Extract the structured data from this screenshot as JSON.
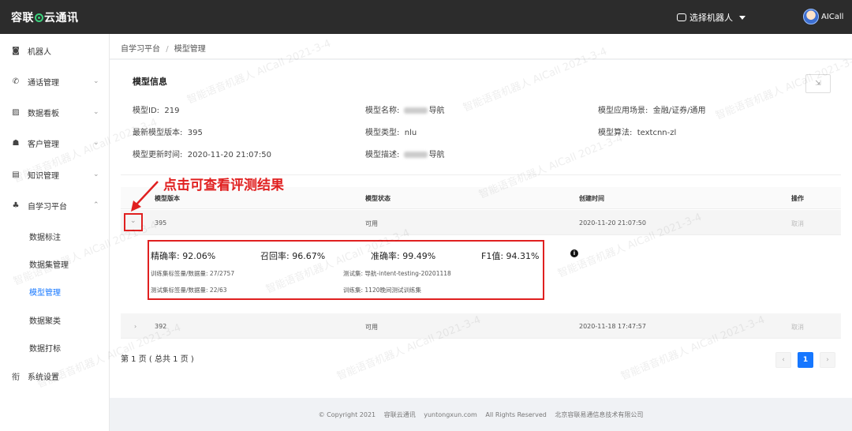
{
  "header": {
    "brand_left": "容联",
    "brand_right": "云通讯",
    "robot_select": "选择机器人",
    "user": "AICall"
  },
  "sidebar": {
    "items": [
      {
        "label": "机器人",
        "icon": "robot-icon"
      },
      {
        "label": "通话管理",
        "icon": "phone-icon"
      },
      {
        "label": "数据看板",
        "icon": "chart-icon"
      },
      {
        "label": "客户管理",
        "icon": "users-icon"
      },
      {
        "label": "知识管理",
        "icon": "book-icon"
      },
      {
        "label": "自学习平台",
        "icon": "learn-icon"
      }
    ],
    "subitems": [
      "数据标注",
      "数据集管理",
      "模型管理",
      "数据聚类",
      "数据打标"
    ],
    "last": {
      "label": "系统设置",
      "icon": "settings-icon"
    }
  },
  "breadcrumb": {
    "parent": "自学习平台",
    "sep": "/",
    "current": "模型管理"
  },
  "model_info": {
    "title": "模型信息",
    "id_label": "模型ID:",
    "id": "219",
    "name_label": "模型名称:",
    "name_suffix": "导航",
    "scene_label": "模型应用场景:",
    "scene": "金融/证券/通用",
    "version_label": "最新模型版本:",
    "version": "395",
    "type_label": "模型类型:",
    "type": "nlu",
    "algo_label": "模型算法:",
    "algo": "textcnn-zl",
    "updated_label": "模型更新时间:",
    "updated": "2020-11-20 21:07:50",
    "desc_label": "模型描述:",
    "desc_suffix": "导航"
  },
  "annotation": "点击可查看评测结果",
  "table": {
    "headers": [
      "模型版本",
      "模型状态",
      "创建时间",
      "操作"
    ],
    "rows": [
      {
        "version": "395",
        "status": "可用",
        "created": "2020-11-20 21:07:50",
        "op": "取消"
      },
      {
        "version": "392",
        "status": "可用",
        "created": "2020-11-18 17:47:57",
        "op": "取消"
      }
    ]
  },
  "eval": {
    "precision": "精确率:  92.06%",
    "recall": "召回率:  96.67%",
    "accuracy": "准确率:  99.49%",
    "f1": "F1值:  94.31%",
    "train_label": "训练集标签量/数据量:  27/2757",
    "test_set": "测试集:          导航-intent-testing-20201118",
    "test_label": "测试集标签量/数据量:  22/63",
    "train_set": "训练集:  1120晚间测试训练集"
  },
  "pagination": {
    "text": "第 1 页 ( 总共 1 页 )",
    "prev": "‹",
    "current": "1",
    "next": "›"
  },
  "footer": {
    "copyright": "© Copyright 2021",
    "company_short": "容联云通讯",
    "domain": "yuntongxun.com",
    "rights": "All Rights Reserved",
    "company_full": "北京容联易通信息技术有限公司"
  },
  "watermark": "智能语音机器人 AICall 2021-3-4",
  "colors": {
    "accent": "#1677ff",
    "annotation": "#e02020",
    "topbar": "#2c2c2c",
    "brand_dot": "#3bd07c"
  }
}
